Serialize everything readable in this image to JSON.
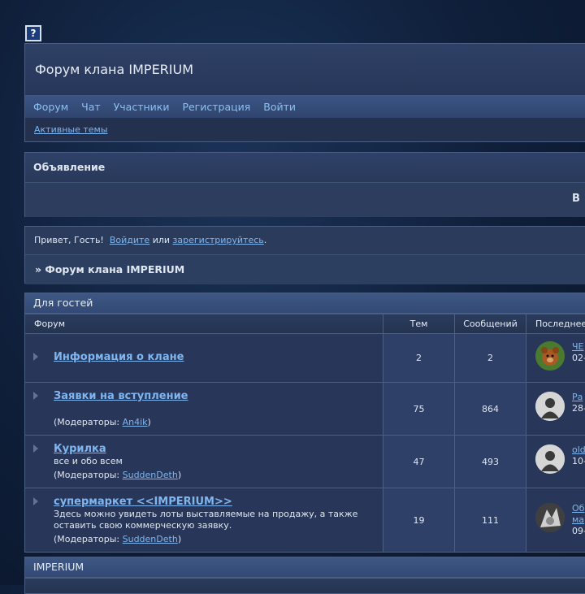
{
  "header": {
    "title": "Форум клана IMPERIUM",
    "nav": [
      "Форум",
      "Чат",
      "Участники",
      "Регистрация",
      "Войти"
    ],
    "subnav": "Активные темы"
  },
  "announcement": {
    "title": "Объявление",
    "text": "В"
  },
  "greeting": {
    "prefix": "Привет, Гость!",
    "login": "Войдите",
    "or": "или",
    "register": "зарегистрируйтесь",
    "suffix": ".",
    "breadcrumb": "» Форум клана IMPERIUM"
  },
  "category1": {
    "title": "Для гостей",
    "columns": {
      "forum": "Форум",
      "topics": "Тем",
      "posts": "Сообщений",
      "last": "Последнее"
    },
    "rows": [
      {
        "name": "Информация о клане",
        "desc": "",
        "mods_label": "",
        "mod": "",
        "mods_end": "",
        "topics": "2",
        "posts": "2",
        "last_user": "ЧЕ",
        "last_date": "02-"
      },
      {
        "name": "Заявки на вступление",
        "desc": "",
        "mods_label": "(Модераторы: ",
        "mod": "An4ik",
        "mods_end": ")",
        "topics": "75",
        "posts": "864",
        "last_user": "Ра",
        "last_date": "28-"
      },
      {
        "name": "Курилка",
        "desc": "все и обо всем",
        "mods_label": "(Модераторы: ",
        "mod": "SuddenDeth",
        "mods_end": ")",
        "topics": "47",
        "posts": "493",
        "last_user": "old",
        "last_date": "10-"
      },
      {
        "name": "супермаркет <<IMPERIUM>>",
        "desc": "Здесь можно увидеть лоты выставляемые на продажу, а также оставить свою коммерческую заявку.",
        "mods_label": "(Модераторы: ",
        "mod": "SuddenDeth",
        "mods_end": ")",
        "topics": "19",
        "posts": "111",
        "last_user": "Об",
        "last_user2": "ма",
        "last_date": "09-"
      }
    ]
  },
  "category2": {
    "title": "IMPERIUM"
  }
}
